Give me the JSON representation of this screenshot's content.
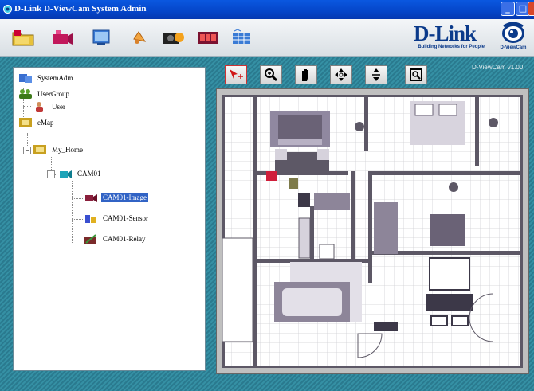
{
  "window": {
    "title": "D-Link D-ViewCam System Admin",
    "controls": {
      "minimize": "_",
      "maximize": "□",
      "close": "×"
    }
  },
  "toolbar": {
    "buttons": [
      {
        "name": "open-folder-tool",
        "icon": "folder-icon"
      },
      {
        "name": "camera-settings-tool",
        "icon": "camera-icon"
      },
      {
        "name": "monitor-tool",
        "icon": "monitor-icon"
      },
      {
        "name": "speaker-tool",
        "icon": "speaker-icon"
      },
      {
        "name": "snapshot-tool",
        "icon": "photo-camera-icon"
      },
      {
        "name": "film-tool",
        "icon": "film-icon"
      },
      {
        "name": "layout-tool",
        "icon": "grid-icon"
      }
    ]
  },
  "brand": {
    "logo": "D-Link",
    "tagline": "Building Networks for People",
    "product_caption": "D-ViewCam",
    "version": "D-ViewCam v1.00"
  },
  "tree": {
    "nodes": [
      {
        "label": "SystemAdm",
        "icon": "admin-icon"
      },
      {
        "label": "UserGroup",
        "icon": "user-group-icon"
      },
      {
        "label": "User",
        "icon": "user-icon"
      },
      {
        "label": "eMap",
        "icon": "emap-icon"
      },
      {
        "label": "My_Home",
        "icon": "map-icon"
      },
      {
        "label": "CAM01",
        "icon": "camera-icon"
      },
      {
        "label": "CAM01-Image",
        "icon": "camera-image-icon",
        "selected": true
      },
      {
        "label": "CAM01-Sensor",
        "icon": "sensor-icon"
      },
      {
        "label": "CAM01-Relay",
        "icon": "relay-icon"
      }
    ],
    "expanders": {
      "my_home": "−",
      "cam01": "−"
    }
  },
  "map_tools": [
    {
      "name": "pointer-tool",
      "icon": "arrow-cursor-icon",
      "active": true
    },
    {
      "name": "zoom-in-tool",
      "icon": "zoom-icon"
    },
    {
      "name": "pan-tool",
      "icon": "hand-icon"
    },
    {
      "name": "move-tool",
      "icon": "move-arrows-icon"
    },
    {
      "name": "vertical-move-tool",
      "icon": "vertical-arrows-icon"
    },
    {
      "name": "fit-tool",
      "icon": "fit-window-icon"
    }
  ]
}
